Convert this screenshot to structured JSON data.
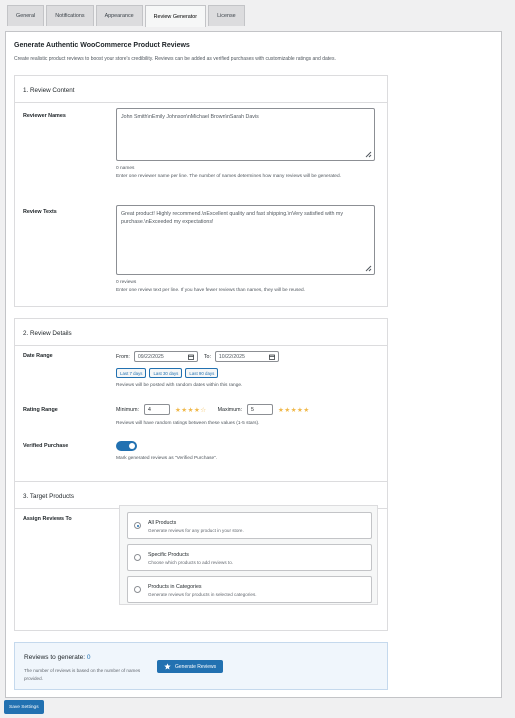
{
  "tabs": [
    "General",
    "Notifications",
    "Appearance",
    "Review Generator",
    "License"
  ],
  "page": {
    "title": "Generate Authentic WooCommerce Product Reviews",
    "description": "Create realistic product reviews to boost your store's credibility. Reviews can be added as verified purchases with customizable ratings and dates."
  },
  "review_content": {
    "title": "1. Review Content",
    "names_label": "Reviewer Names",
    "names_value": "John Smith\\nEmily Johnson\\nMichael Brown\\nSarah Davis",
    "names_count": "0 names",
    "names_help": "Enter one reviewer name per line. The number of names determines how many reviews will be generated.",
    "texts_label": "Review Texts",
    "texts_value": "Great product! Highly recommend.\\nExcellent quality and fast shipping.\\nVery satisfied with my purchase.\\nExceeded my expectations!",
    "texts_count": "0 reviews",
    "texts_help": "Enter one review text per line. If you have fewer reviews than names, they will be reused."
  },
  "review_details": {
    "title": "2. Review Details",
    "date_label": "Date Range",
    "from_label": "From:",
    "from_value": "09/22/2025",
    "to_label": "To:",
    "to_value": "10/22/2025",
    "quick": [
      "Last 7 days",
      "Last 30 days",
      "Last 90 days"
    ],
    "date_help": "Reviews will be posted with random dates within this range.",
    "rating_label": "Rating Range",
    "min_label": "Minimum:",
    "min_value": "4",
    "min_stars": "★★★★☆",
    "max_label": "Maximum:",
    "max_value": "5",
    "max_stars": "★★★★★",
    "rating_help": "Reviews will have random ratings between these values (1-5 stars).",
    "verified_label": "Verified Purchase",
    "verified_on": true,
    "verified_help": "Mark generated reviews as \"Verified Purchase\"."
  },
  "target": {
    "title": "3. Target Products",
    "assign_label": "Assign Reviews To",
    "options": [
      {
        "title": "All Products",
        "desc": "Generate reviews for any product in your store.",
        "checked": true
      },
      {
        "title": "Specific Products",
        "desc": "Choose which products to add reviews to.",
        "checked": false
      },
      {
        "title": "Products in Categories",
        "desc": "Generate reviews for products in selected categories.",
        "checked": false
      }
    ]
  },
  "generate": {
    "label": "Reviews to generate:",
    "count": "0",
    "desc": "The number of reviews is based on the number of names provided.",
    "button": "Generate Reviews"
  },
  "save_button": "Save Settings",
  "colors": {
    "accent": "#2271b1",
    "star": "#f0b849"
  }
}
